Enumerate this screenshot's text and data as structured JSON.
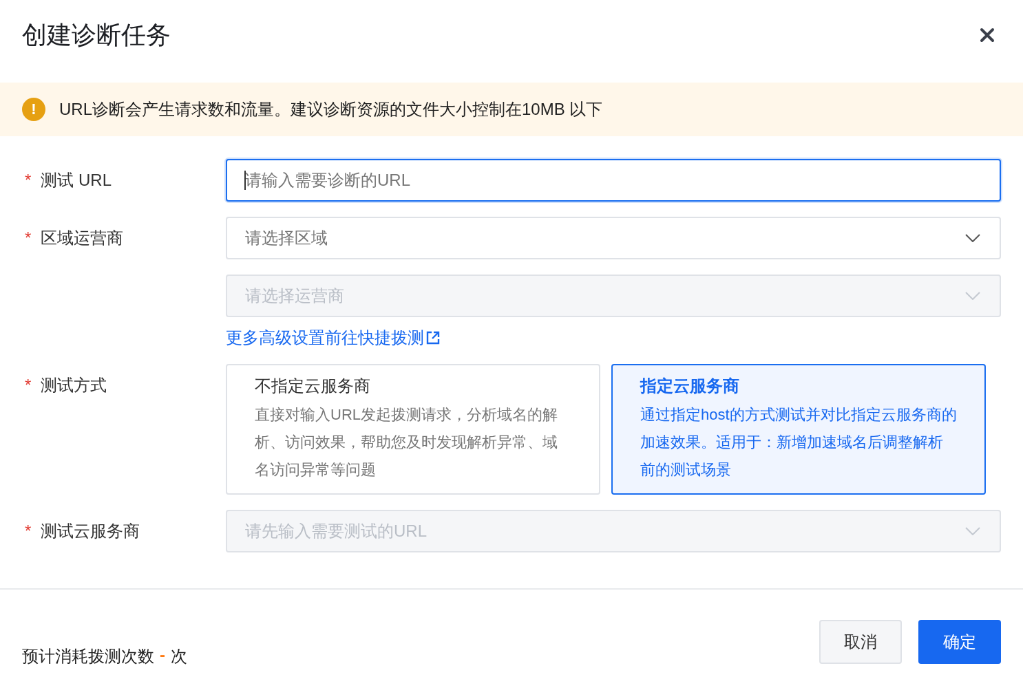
{
  "dialog": {
    "title": "创建诊断任务"
  },
  "alert": {
    "icon_text": "!",
    "text": "URL诊断会产生请求数和流量。建议诊断资源的文件大小控制在10MB 以下"
  },
  "form": {
    "rows": [
      {
        "kind": "input",
        "required_mark": "*",
        "label": "测试 URL",
        "fields": [
          {
            "placeholder": "请输入需要诊断的URL",
            "focused": true,
            "disabled": false
          }
        ]
      },
      {
        "kind": "select",
        "required_mark": "*",
        "label": "区域运营商",
        "fields": [
          {
            "placeholder": "请选择区域",
            "disabled": false
          },
          {
            "placeholder": "请选择运营商",
            "disabled": true
          }
        ],
        "link": "更多高级设置前往快捷拨测"
      },
      {
        "kind": "cards",
        "required_mark": "*",
        "label": "测试方式",
        "options": [
          {
            "title": "不指定云服务商",
            "description": "直接对输入URL发起拨测请求，分析域名的解析、访问效果，帮助您及时发现解析异常、域名访问异常等问题",
            "selected": false
          },
          {
            "title": "指定云服务商",
            "description": "通过指定host的方式测试并对比指定云服务商的加速效果。适用于：新增加速域名后调整解析前的测试场景",
            "selected": true
          }
        ]
      },
      {
        "kind": "select",
        "required_mark": "*",
        "label": "测试云服务商",
        "fields": [
          {
            "placeholder": "请先输入需要测试的URL",
            "disabled": true
          }
        ]
      }
    ]
  },
  "footer": {
    "estimate_label": "预计消耗拨测次数",
    "estimate_value": "-",
    "estimate_unit": "次",
    "buttons": [
      {
        "label": "取消",
        "kind": "secondary"
      },
      {
        "label": "确定",
        "kind": "primary"
      }
    ]
  }
}
